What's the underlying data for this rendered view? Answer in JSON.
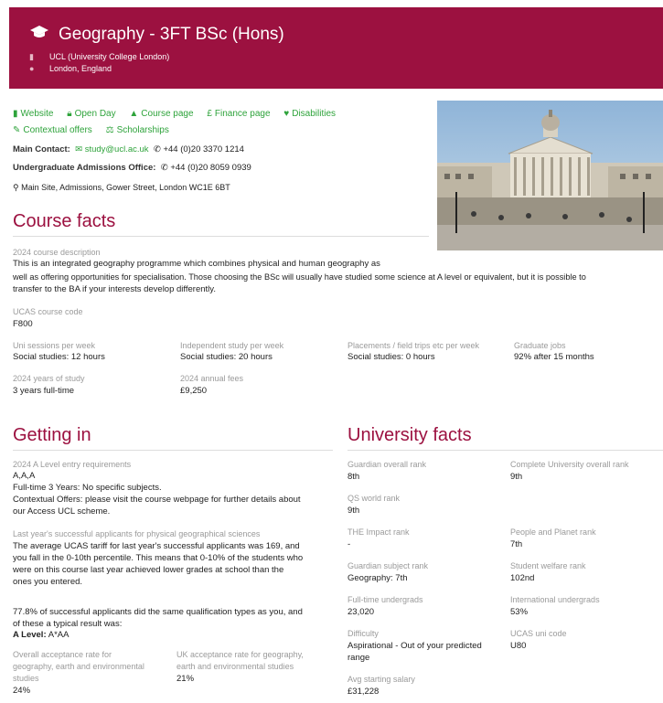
{
  "header": {
    "title": "Geography - 3FT BSc (Hons)",
    "university": "UCL (University College London)",
    "location": "London, England"
  },
  "links": [
    {
      "icon": "bookmark-icon",
      "glyph": "▮",
      "label": "Website"
    },
    {
      "icon": "lock-icon",
      "glyph": "🔒",
      "label": "Open Day"
    },
    {
      "icon": "graduation-cap-icon",
      "glyph": "🎓",
      "label": "Course page"
    },
    {
      "icon": "pound-icon",
      "glyph": "£",
      "label": "Finance page"
    },
    {
      "icon": "heart-icon",
      "glyph": "♥",
      "label": "Disabilities"
    },
    {
      "icon": "pencil-icon",
      "glyph": "✎",
      "label": "Contextual offers"
    },
    {
      "icon": "scales-icon",
      "glyph": "⚖",
      "label": "Scholarships"
    }
  ],
  "contacts": {
    "main_label": "Main Contact:",
    "main_email": "study@ucl.ac.uk",
    "main_phone": "+44 (0)20 3370 1214",
    "admissions_label": "Undergraduate Admissions Office:",
    "admissions_phone": "+44 (0)20 8059 0939",
    "address": "Main Site, Admissions, Gower Street, London WC1E 6BT"
  },
  "course_facts": {
    "heading": "Course facts",
    "desc_label": "2024 course description",
    "desc_line1": "This is an integrated geography programme which combines physical and human geography as",
    "desc_line2": "well as offering opportunities for specialisation. Those choosing the BSc will usually have studied some science at A level or equivalent, but it is possible to",
    "desc_line3": "transfer to the BA if your interests develop differently.",
    "ucas_label": "UCAS course code",
    "ucas_value": "F800",
    "uni_sessions_label": "Uni sessions per week",
    "uni_sessions_value": "Social studies: 12 hours",
    "independent_label": "Independent study per week",
    "independent_value": "Social studies: 20 hours",
    "placements_label": "Placements / field trips etc per week",
    "placements_value": "Social studies: 0 hours",
    "grad_jobs_label": "Graduate jobs",
    "grad_jobs_value": "92% after 15 months",
    "years_label": "2024 years of study",
    "years_value": "3 years full-time",
    "fees_label": "2024 annual fees",
    "fees_value": "£9,250"
  },
  "getting_in": {
    "heading": "Getting in",
    "entry_label": "2024 A Level entry requirements",
    "entry_value": "A,A,A",
    "entry_line2": "Full-time 3 Years: No specific subjects.",
    "entry_line3": "Contextual Offers: please visit the course webpage for further details about",
    "entry_line4": "our Access UCL scheme.",
    "last_year_label": "Last year's successful applicants for physical geographical sciences",
    "last_year_1": "The average UCAS tariff for last year's successful applicants was 169, and",
    "last_year_2": "you fall in the 0-10th percentile. This means that 0-10% of the students who",
    "last_year_3": "were on this course last year achieved lower grades at school than the",
    "last_year_4": "ones you entered.",
    "qual_1": "77.8% of successful applicants did the same qualification types as you, and",
    "qual_2": "of these a typical result was:",
    "result_label": "A Level:",
    "result_value": "A*AA",
    "overall_label_1": "Overall acceptance rate for",
    "overall_label_2": "geography, earth and environmental",
    "overall_label_3": "studies",
    "overall_value": "24%",
    "uk_label_1": "UK acceptance rate for geography,",
    "uk_label_2": "earth and environmental studies",
    "uk_value": "21%"
  },
  "university_facts": {
    "heading": "University facts",
    "guardian_label": "Guardian overall rank",
    "guardian_value": "8th",
    "complete_label": "Complete University overall rank",
    "complete_value": "9th",
    "qs_label": "QS world rank",
    "qs_value": "9th",
    "the_label": "THE Impact rank",
    "the_value": "-",
    "pp_label": "People and Planet rank",
    "pp_value": "7th",
    "gsubj_label": "Guardian subject rank",
    "gsubj_value": "Geography: 7th",
    "welfare_label": "Student welfare rank",
    "welfare_value": "102nd",
    "ft_label": "Full-time undergrads",
    "ft_value": "23,020",
    "intl_label": "International undergrads",
    "intl_value": "53%",
    "diff_label": "Difficulty",
    "diff_value_1": "Aspirational - Out of your predicted",
    "diff_value_2": "range",
    "ucas_uni_label": "UCAS uni code",
    "ucas_uni_value": "U80",
    "salary_label": "Avg starting salary",
    "salary_value": "£31,228"
  },
  "colors": {
    "brand": "#9c1140",
    "link": "#2ea33b",
    "muted": "#9a9a9a"
  }
}
